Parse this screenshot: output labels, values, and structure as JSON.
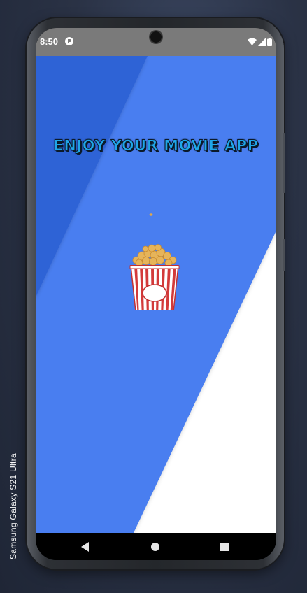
{
  "device": {
    "label": "Samsung Galaxy  S21 Ultra"
  },
  "status_bar": {
    "time": "8:50",
    "app_icon": "app-notification-icon",
    "indicators": [
      "wifi-icon",
      "signal-icon",
      "battery-icon"
    ]
  },
  "splash": {
    "title": "ENJOY YOUR MOVIE APP",
    "image": "popcorn-bucket",
    "colors": {
      "primary_blue": "#4a7ef0",
      "dark_blue": "#2f64d6",
      "white": "#ffffff",
      "title_fill": "#1fa6e8",
      "title_outline": "#0b1a2a"
    }
  },
  "navigation_bar": {
    "buttons": [
      "back-icon",
      "home-icon",
      "recents-icon"
    ]
  }
}
